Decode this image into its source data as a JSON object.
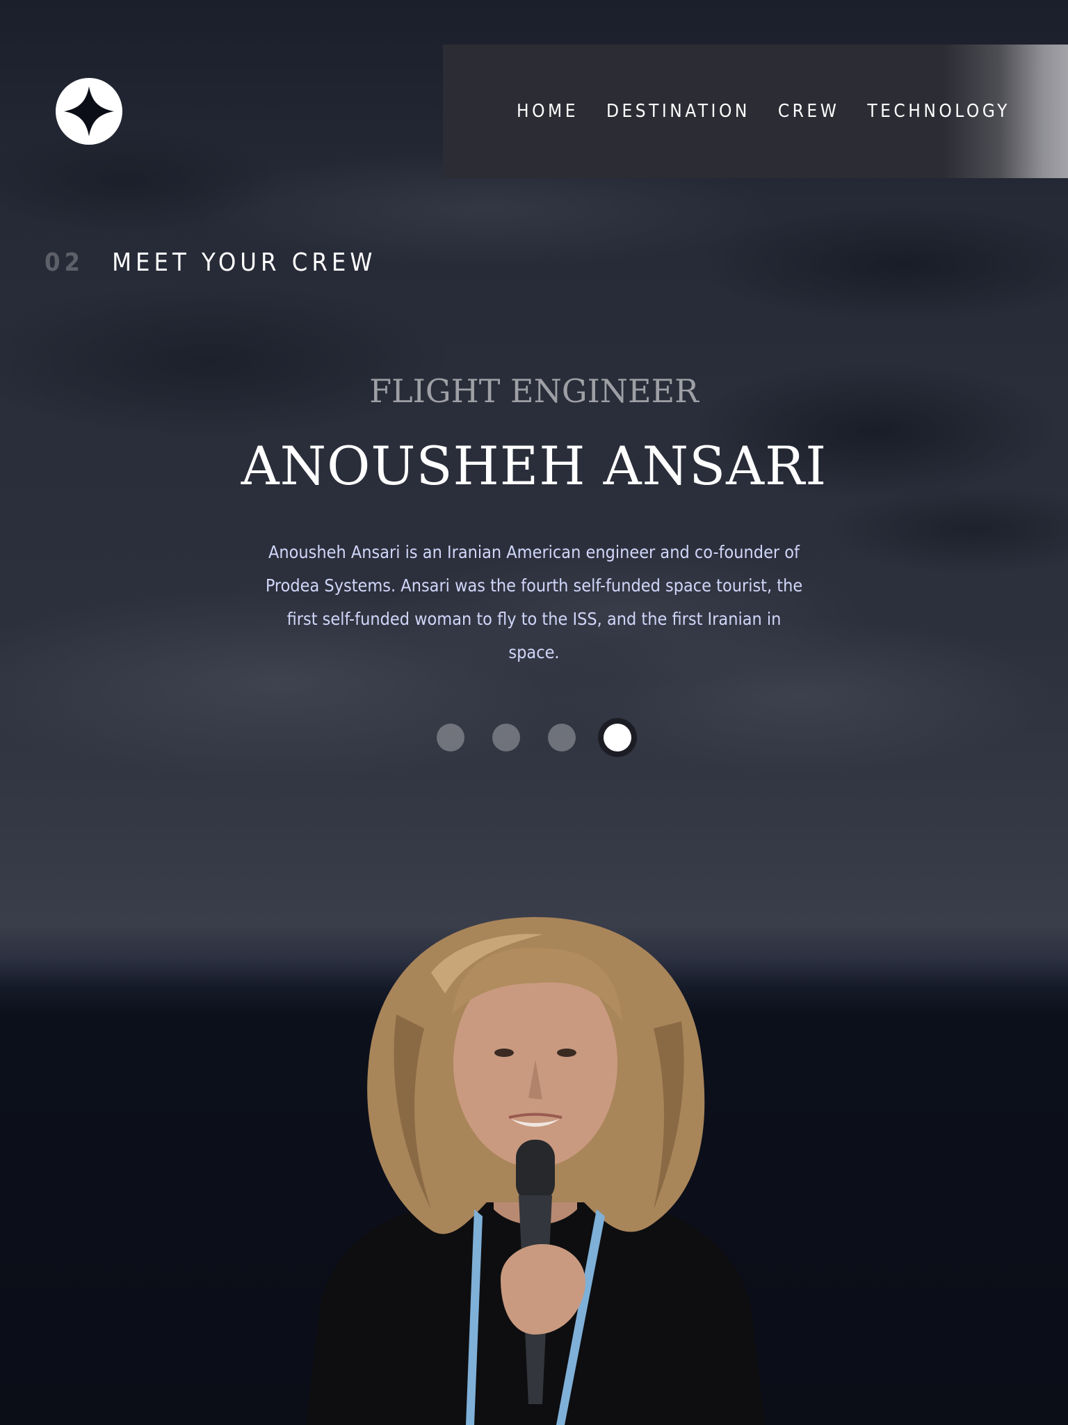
{
  "header": {
    "logo_icon": "star-logo-icon",
    "nav": [
      {
        "label": "HOME"
      },
      {
        "label": "DESTINATION"
      },
      {
        "label": "CREW"
      },
      {
        "label": "TECHNOLOGY"
      }
    ]
  },
  "section": {
    "number": "02",
    "title": "MEET YOUR CREW"
  },
  "crew": {
    "role": "FLIGHT ENGINEER",
    "name": "ANOUSHEH ANSARI",
    "bio": "Anousheh Ansari is an Iranian American engineer and co-founder of Prodea Systems. Ansari was the fourth self-funded space tourist, the first self-funded woman to fly to the ISS, and the first Iranian in space.",
    "slides": 4,
    "active_slide": 4
  },
  "colors": {
    "background": "#0b0d17",
    "text": "#ffffff",
    "bio_text": "#d0d6f9"
  }
}
